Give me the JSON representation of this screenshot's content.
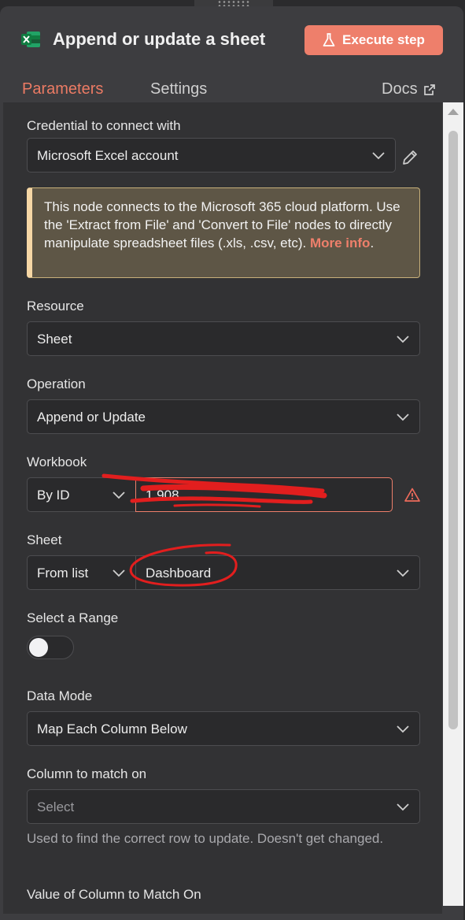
{
  "header": {
    "node_icon": "excel-icon",
    "title": "Append or update a sheet",
    "execute_label": "Execute step",
    "execute_icon": "flask-icon",
    "accent": "#ee7f6b"
  },
  "tabs": [
    {
      "label": "Parameters",
      "active": true
    },
    {
      "label": "Settings",
      "active": false
    },
    {
      "label": "Docs",
      "icon": "external-link-icon"
    }
  ],
  "credential": {
    "label": "Credential to connect with",
    "value": "Microsoft Excel account"
  },
  "notice": {
    "text": "This node connects to the Microsoft 365 cloud platform. Use the 'Extract from File' and 'Convert to File' nodes to directly manipulate spreadsheet files (.xls, .csv, etc). ",
    "link_text": "More info",
    "end": "."
  },
  "resource": {
    "label": "Resource",
    "value": "Sheet"
  },
  "operation": {
    "label": "Operation",
    "value": "Append or Update"
  },
  "workbook": {
    "label": "Workbook",
    "mode": "By ID",
    "value": "1        908",
    "status_icon": "warning-icon"
  },
  "sheet": {
    "label": "Sheet",
    "mode": "From list",
    "value": "Dashboard"
  },
  "range": {
    "label": "Select a Range",
    "enabled": false
  },
  "data_mode": {
    "label": "Data Mode",
    "value": "Map Each Column Below"
  },
  "match_column": {
    "label": "Column to match on",
    "placeholder": "Select",
    "hint": "Used to find the correct row to update. Doesn't get changed."
  },
  "match_value": {
    "label": "Value of Column to Match On"
  }
}
